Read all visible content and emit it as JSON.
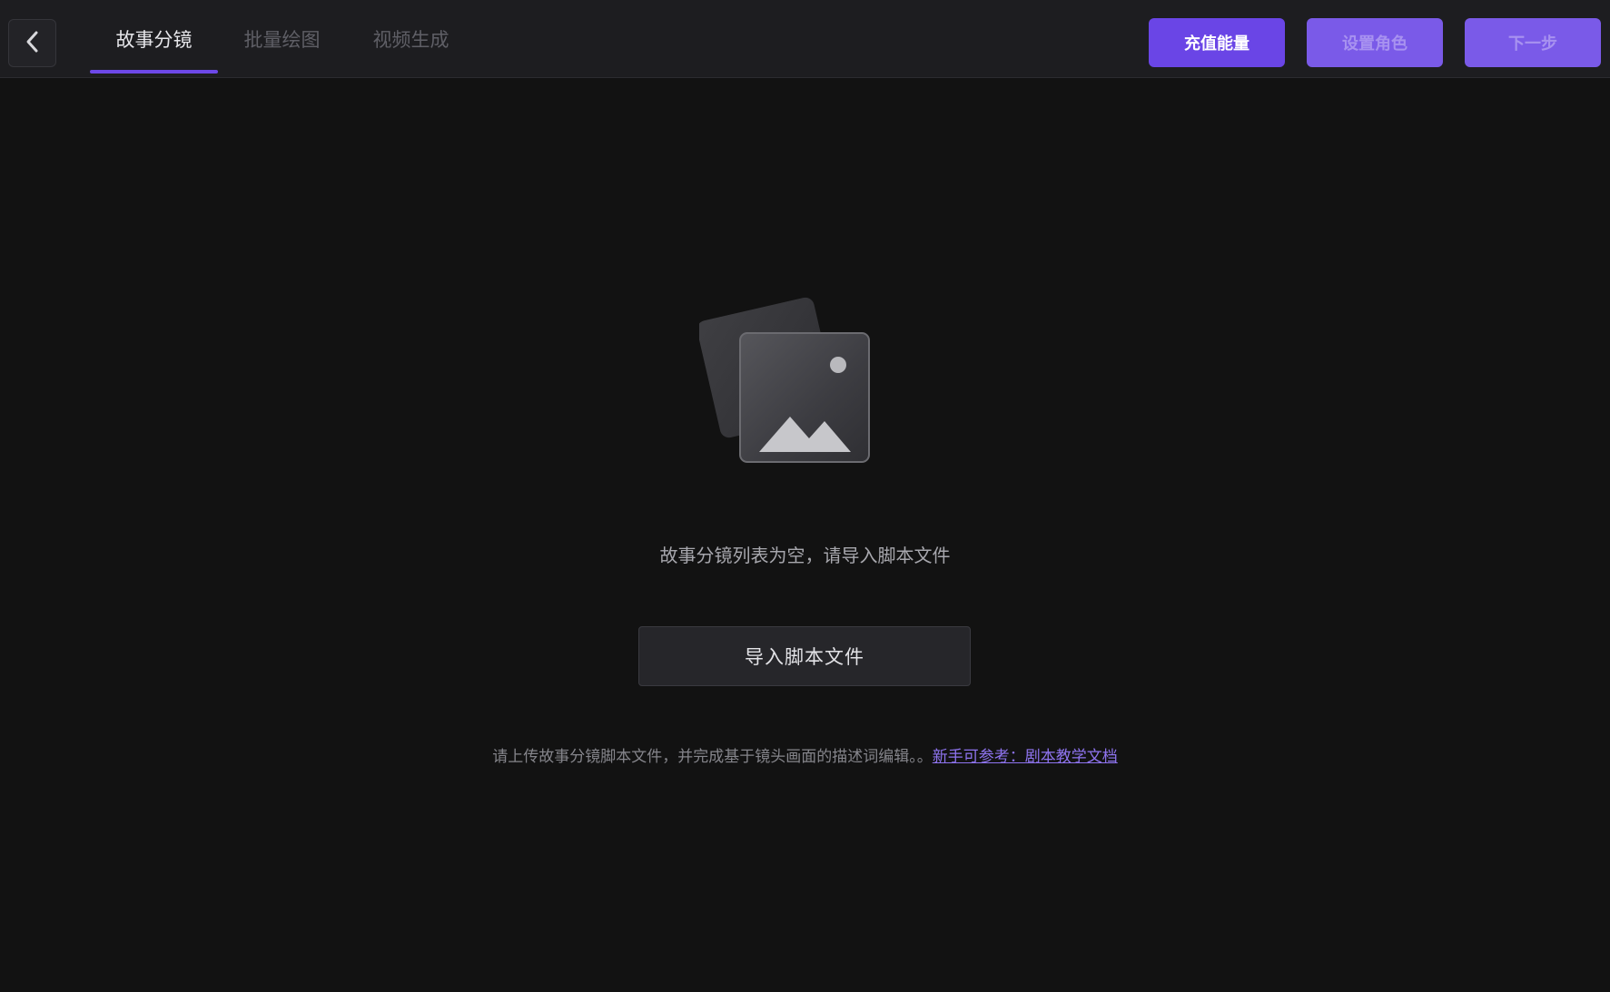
{
  "header": {
    "back_icon": "chevron-left-icon",
    "tabs": [
      {
        "label": "故事分镜",
        "active": true
      },
      {
        "label": "批量绘图",
        "active": false
      },
      {
        "label": "视频生成",
        "active": false
      }
    ],
    "buttons": {
      "recharge": "充值能量",
      "set_role": "设置角色",
      "next_step": "下一步"
    }
  },
  "main": {
    "empty_icon": "image-placeholder-icon",
    "empty_text": "故事分镜列表为空，请导入脚本文件",
    "import_button": "导入脚本文件",
    "hint_text": "请上传故事分镜脚本文件，并完成基于镜头画面的描述词编辑。。",
    "hint_link": "新手可参考：剧本教学文档"
  },
  "colors": {
    "background": "#121212",
    "header_bg": "#1d1d20",
    "accent": "#6a45e6",
    "link": "#8f74f0"
  }
}
